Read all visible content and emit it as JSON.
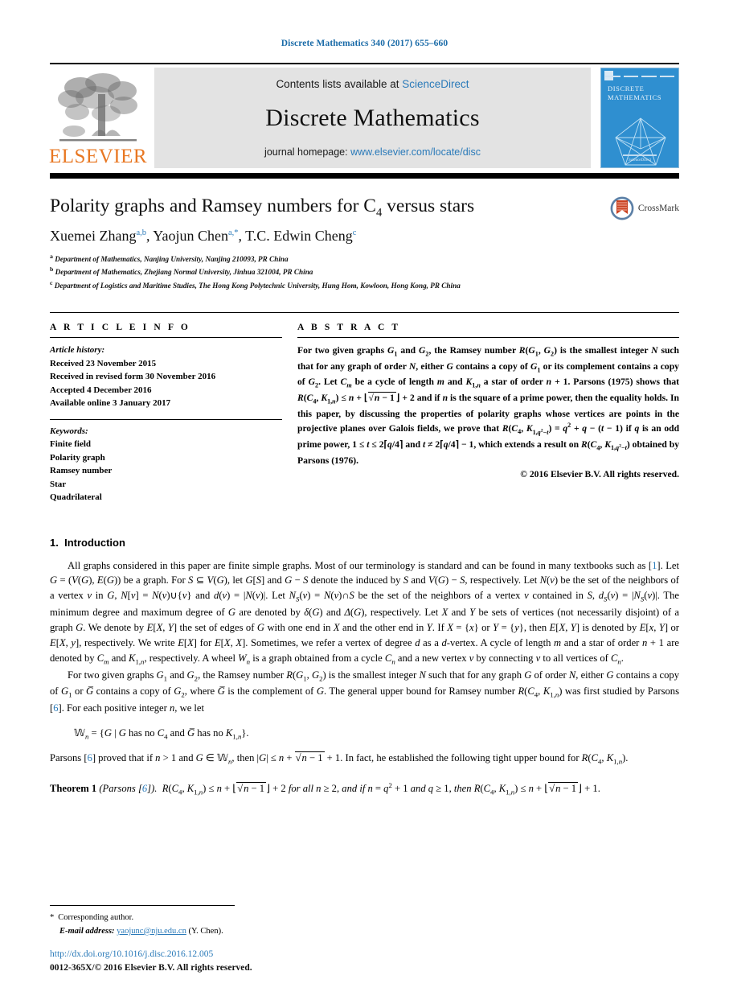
{
  "running_head": "Discrete Mathematics 340 (2017) 655–660",
  "masthead": {
    "contents_prefix": "Contents lists available at ",
    "contents_link": "ScienceDirect",
    "journal_name": "Discrete Mathematics",
    "homepage_prefix": "journal homepage: ",
    "homepage_link": "www.elsevier.com/locate/disc",
    "publisher_logo_text": "ELSEVIER",
    "publisher_logo_icon": "elsevier-tree-icon",
    "cover_title_line1": "DISCRETE",
    "cover_title_line2": "MATHEMATICS",
    "cover_footer_text": "ScienceDirect"
  },
  "title": {
    "text_before": "Polarity graphs and Ramsey numbers for C",
    "sub": "4",
    "text_after": " versus stars"
  },
  "crossmark": {
    "label": "CrossMark",
    "icon": "crossmark-icon"
  },
  "authors": [
    {
      "name": "Xuemei Zhang",
      "marks": "a,b",
      "sep": ", "
    },
    {
      "name": "Yaojun Chen",
      "marks": "a,*",
      "sep": ", "
    },
    {
      "name": "T.C. Edwin Cheng",
      "marks": "c",
      "sep": ""
    }
  ],
  "affiliations": [
    {
      "mark": "a",
      "text": "Department of Mathematics, Nanjing University, Nanjing 210093, PR China"
    },
    {
      "mark": "b",
      "text": "Department of Mathematics, Zhejiang Normal University, Jinhua 321004, PR China"
    },
    {
      "mark": "c",
      "text": "Department of Logistics and Maritime Studies, The Hong Kong Polytechnic University, Hung Hom, Kowloon, Hong Kong, PR China"
    }
  ],
  "article_info": {
    "heading": "A R T I C L E   I N F O",
    "history_label": "Article history:",
    "history": [
      "Received 23 November 2015",
      "Received in revised form 30 November 2016",
      "Accepted 4 December 2016",
      "Available online 3 January 2017"
    ],
    "keywords_label": "Keywords:",
    "keywords": [
      "Finite field",
      "Polarity graph",
      "Ramsey number",
      "Star",
      "Quadrilateral"
    ]
  },
  "abstract": {
    "heading": "A B S T R A C T",
    "p1_a": "For two given graphs ",
    "g1": "G",
    "g1sub": "1",
    "p1_b": " and ",
    "g2": "G",
    "g2sub": "2",
    "p1_c": ", the Ramsey number ",
    "rfun": "R(G",
    "p1_d": ") is the smallest integer ",
    "n": "N",
    "p1_e": " such that for any graph of order ",
    "p1_f": ", either ",
    "g": "G",
    "p1_g": " contains a copy of ",
    "p1_h": " or its complement contains a copy of ",
    "p1_i": ". Let ",
    "cm": "C",
    "cmsub": "m",
    "p1_j": " be a cycle of length ",
    "m": "m",
    "p1_k": " and ",
    "k1n": "K",
    "k1nsub": "1,n",
    "p1_l": " a star of order ",
    "nvar": "n",
    "p1_m": " + 1. Parsons (1975) shows that ",
    "p1_n": " and if ",
    "p1_o": " is the square of a prime power, then the equality holds. In this paper, by discussing the properties of polarity graphs whose vertices are points in the projective planes over Galois fields, we prove that",
    "p1_p": " if ",
    "q": "q",
    "p1_q": " is an odd prime power, ",
    "p1_r": " and ",
    "p1_s": ", which extends a result on ",
    "p1_t": " obtained by Parsons (1976).",
    "copyright": "© 2016 Elsevier B.V. All rights reserved."
  },
  "section": {
    "number": "1.",
    "title": "Introduction"
  },
  "paragraphs": {
    "p1": "All graphs considered in this paper are finite simple graphs. Most of our terminology is standard and can be found in many textbooks such as [1]. Let G = (V(G), E(G)) be a graph. For S ⊆ V(G), let G[S] and G − S denote the induced by S and V(G) − S, respectively. Let N(v) be the set of the neighbors of a vertex v in G, N[v] = N(v) ∪ {v} and d(v) = |N(v)|. Let N_S(v) = N(v) ∩ S be the set of the neighbors of a vertex v contained in S, d_S(v) = |N_S(v)|. The minimum degree and maximum degree of G are denoted by δ(G) and Δ(G), respectively. Let X and Y be sets of vertices (not necessarily disjoint) of a graph G. We denote by E[X, Y] the set of edges of G with one end in X and the other end in Y. If X = {x} or Y = {y}, then E[X, Y] is denoted by E[x, Y] or E[X, y], respectively. We write E[X] for E[X, X]. Sometimes, we refer a vertex of degree d as a d-vertex. A cycle of length m and a star of order n + 1 are denoted by C_m and K_{1,n}, respectively. A wheel W_n is a graph obtained from a cycle C_n and a new vertex v by connecting v to all vertices of C_n.",
    "p2": "For two given graphs G1 and G2, the Ramsey number R(G1, G2) is the smallest integer N such that for any graph G of order N, either G contains a copy of G1 or Ḡ contains a copy of G2, where Ḡ is the complement of G. The general upper bound for Ramsey number R(C4, K1,n) was first studied by Parsons [6]. For each positive integer n, we let",
    "equation": "Gn = {G | G has no C4 and Ḡ has no K1,n}.",
    "p3": "Parsons [6] proved that if n > 1 and G ∈ Gn, then |G| ≤ n + √(n − 1) + 1. In fact, he established the following tight upper bound for R(C4, K1,n).",
    "theorem_label": "Theorem 1",
    "theorem_source": "(Parsons [6]).",
    "theorem_body": "R(C4, K1,n) ≤ n + ⌊√(n − 1)⌋ + 2 for all n ≥ 2, and if n = q² + 1 and q ≥ 1, then R(C4, K1,n) ≤ n + ⌊√(n − 1)⌋ + 1."
  },
  "footnote": {
    "star": "*",
    "corresponding": "Corresponding author.",
    "email_label": "E-mail address:",
    "email": "yaojunc@nju.edu.cn",
    "email_owner": "(Y. Chen)."
  },
  "doi": "http://dx.doi.org/10.1016/j.disc.2016.12.005",
  "issn_line": "0012-365X/© 2016 Elsevier B.V. All rights reserved.",
  "colors": {
    "link": "#2a7ab9",
    "elsevier_orange": "#E87722",
    "cover_blue": "#2f8fd0",
    "masthead_gray": "#e3e3e3"
  }
}
